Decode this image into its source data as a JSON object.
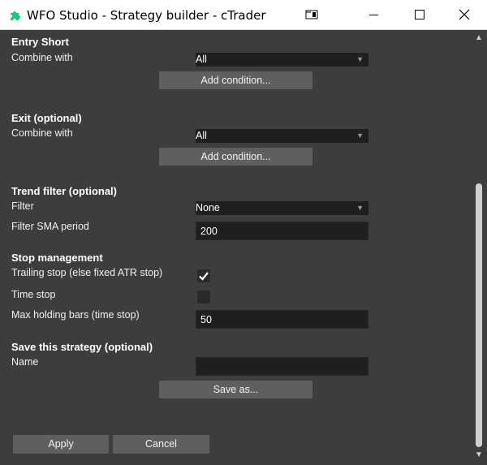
{
  "window": {
    "title": "WFO Studio - Strategy builder - cTrader",
    "icons": {
      "app": "puzzle-piece-icon",
      "snap": "window-snap-icon",
      "minimize": "minimize-icon",
      "maximize": "maximize-icon",
      "close": "close-icon"
    },
    "brand_color": "#1ec773"
  },
  "entry_short": {
    "heading": "Entry Short",
    "combine_label": "Combine with",
    "combine_value": "All",
    "add_button": "Add condition..."
  },
  "exit": {
    "heading": "Exit (optional)",
    "combine_label": "Combine with",
    "combine_value": "All",
    "add_button": "Add condition..."
  },
  "trend_filter": {
    "heading": "Trend filter (optional)",
    "filter_label": "Filter",
    "filter_value": "None",
    "sma_label": "Filter SMA period",
    "sma_value": "200"
  },
  "stop_management": {
    "heading": "Stop management",
    "trailing_label": "Trailing stop (else fixed ATR stop)",
    "trailing_checked": true,
    "time_stop_label": "Time stop",
    "time_stop_checked": false,
    "max_bars_label": "Max holding bars (time stop)",
    "max_bars_value": "50"
  },
  "save": {
    "heading": "Save this strategy (optional)",
    "name_label": "Name",
    "name_value": "",
    "save_button": "Save as..."
  },
  "footer": {
    "apply": "Apply",
    "cancel": "Cancel"
  }
}
